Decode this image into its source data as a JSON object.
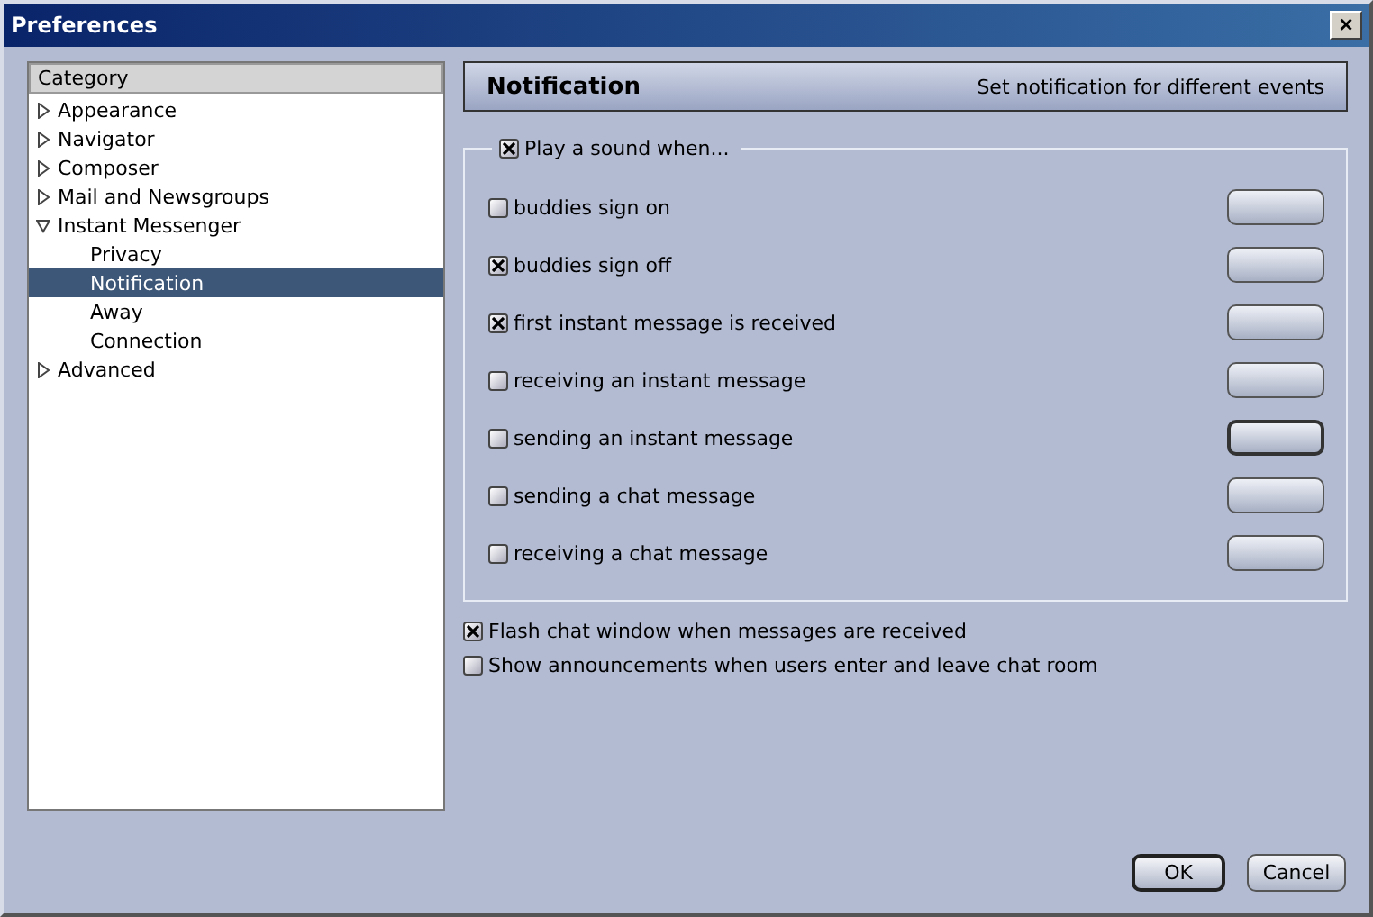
{
  "window": {
    "title": "Preferences",
    "close": "×"
  },
  "tree": {
    "header": "Category",
    "items": [
      {
        "label": "Appearance",
        "expanded": false,
        "selected": false
      },
      {
        "label": "Navigator",
        "expanded": false,
        "selected": false
      },
      {
        "label": "Composer",
        "expanded": false,
        "selected": false
      },
      {
        "label": "Mail and Newsgroups",
        "expanded": false,
        "selected": false
      },
      {
        "label": "Instant Messenger",
        "expanded": true,
        "selected": false,
        "children": [
          {
            "label": "Privacy",
            "selected": false
          },
          {
            "label": "Notification",
            "selected": true
          },
          {
            "label": "Away",
            "selected": false
          },
          {
            "label": "Connection",
            "selected": false
          }
        ]
      },
      {
        "label": "Advanced",
        "expanded": false,
        "selected": false
      }
    ]
  },
  "panel": {
    "title": "Notification",
    "subtitle": "Set notification for different events"
  },
  "sound_group": {
    "label": "Play a sound when...",
    "checked": true,
    "rows": [
      {
        "label": "buddies sign on",
        "checked": false,
        "focused": false
      },
      {
        "label": "buddies sign off",
        "checked": true,
        "focused": false
      },
      {
        "label": "first instant message is received",
        "checked": true,
        "focused": false
      },
      {
        "label": "receiving an instant message",
        "checked": false,
        "focused": false
      },
      {
        "label": "sending an instant message",
        "checked": false,
        "focused": true
      },
      {
        "label": "sending a chat message",
        "checked": false,
        "focused": false
      },
      {
        "label": "receiving a chat message",
        "checked": false,
        "focused": false
      }
    ]
  },
  "options": [
    {
      "label": "Flash chat window when messages are received",
      "checked": true
    },
    {
      "label": "Show announcements when users enter and leave chat room",
      "checked": false
    }
  ],
  "buttons": [
    {
      "label": "OK",
      "default": true
    },
    {
      "label": "Cancel",
      "default": false
    }
  ]
}
